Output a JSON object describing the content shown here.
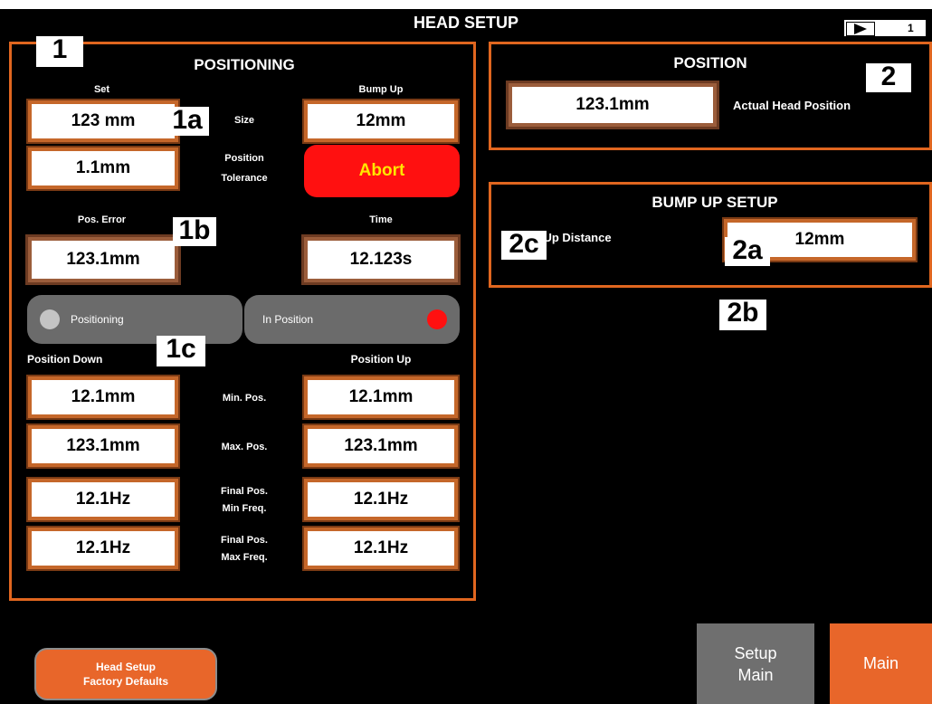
{
  "header": {
    "title": "HEAD SETUP",
    "page_number": "1",
    "page_icon": "play-arrow-icon"
  },
  "positioning": {
    "title": "POSITIONING",
    "set_label": "Set",
    "bump_up_label": "Bump Up",
    "size_label": "Size",
    "set_value": "123 mm",
    "bump_up_value": "12mm",
    "tolerance_label_1": "Position",
    "tolerance_label_2": "Tolerance",
    "tolerance_value": "1.1mm",
    "abort_label": "Abort",
    "pos_error_label": "Pos. Error",
    "time_label": "Time",
    "pos_error_value": "123.1mm",
    "time_value": "12.123s",
    "toggle_left": "Positioning",
    "toggle_right": "In Position",
    "position_down_label": "Position Down",
    "position_up_label": "Position Up",
    "rows": [
      {
        "label_1": "Min. Pos.",
        "label_2": "",
        "down": "12.1mm",
        "up": "12.1mm"
      },
      {
        "label_1": "Max. Pos.",
        "label_2": "",
        "down": "123.1mm",
        "up": "123.1mm"
      },
      {
        "label_1": "Final Pos.",
        "label_2": "Min Freq.",
        "down": "12.1Hz",
        "up": "12.1Hz"
      },
      {
        "label_1": "Final Pos.",
        "label_2": "Max Freq.",
        "down": "12.1Hz",
        "up": "12.1Hz"
      }
    ]
  },
  "position": {
    "title": "POSITION",
    "value": "123.1mm",
    "label": "Actual Head Position"
  },
  "bump_up_setup": {
    "title": "BUMP UP SETUP",
    "label": "Bump Up Distance",
    "value": "12mm"
  },
  "markers": {
    "m1": "1",
    "m1a": "1a",
    "m1b": "1b",
    "m1c": "1c",
    "m2": "2",
    "m2a": "2a",
    "m2b": "2b",
    "m2c": "2c"
  },
  "buttons": {
    "factory_line_1": "Head Setup",
    "factory_line_2": "Factory Defaults",
    "setup_main_line_1": "Setup",
    "setup_main_line_2": "Main",
    "main": "Main"
  },
  "colors": {
    "accent_orange": "#e0661f",
    "abort_red": "#ff1010",
    "abort_text": "#ffe600",
    "background": "#000000"
  }
}
